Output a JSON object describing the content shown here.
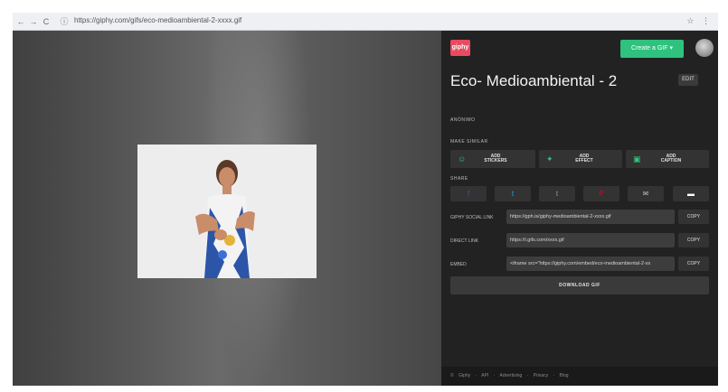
{
  "browser": {
    "url": "https://giphy.com/gifs/eco-medioambiental-2-xxxx.gif",
    "nav": {
      "back": "←",
      "forward": "→",
      "reload": "C"
    },
    "icons": "☆ ⋮"
  },
  "header": {
    "logo_text": "giphy",
    "create_button": "Create a GIF",
    "create_chevron": "▾"
  },
  "gif": {
    "title": "Eco- Medioambiental - 2",
    "edit_label": "EDIT"
  },
  "sections": {
    "uploaded_by": "ANÓNIMO",
    "make_similar": "MAKE SIMILAR",
    "share": "SHARE"
  },
  "add_buttons": [
    {
      "icon": "☺",
      "line1": "ADD",
      "line2": "STICKERS"
    },
    {
      "icon": "✦",
      "line1": "ADD",
      "line2": "EFFECT"
    },
    {
      "icon": "▣",
      "line1": "ADD",
      "line2": "CAPTION"
    }
  ],
  "share_buttons": [
    {
      "icon": "f",
      "color": "#3b5998"
    },
    {
      "icon": "t",
      "color": "#1da1f2"
    },
    {
      "icon": "t",
      "color": "#35465c"
    },
    {
      "icon": "P",
      "color": "#e60023"
    },
    {
      "icon": "✉",
      "color": "#bbbbbb"
    },
    {
      "icon": "▬",
      "color": "#ffffff"
    }
  ],
  "links": [
    {
      "label": "GIPHY SOCIAL LINK",
      "value": "https://gph.is/giphy-medioambiental-2-xxxx.gif",
      "copy": "COPY"
    },
    {
      "label": "DIRECT LINK",
      "value": "https://i.gifs.com/xxxx.gif",
      "copy": "COPY"
    },
    {
      "label": "EMBED",
      "value": "<iframe src=\"https://giphy.com/embed/eco-medioambiental-2-xx",
      "copy": "COPY"
    }
  ],
  "download_label": "DOWNLOAD GIF",
  "footer": "© Giphy · API · Advertising · Privacy · Blog",
  "colors": {
    "accent_green": "#2ec27e",
    "logo_pink": "#e84a5f",
    "panel_bg": "#222222"
  }
}
